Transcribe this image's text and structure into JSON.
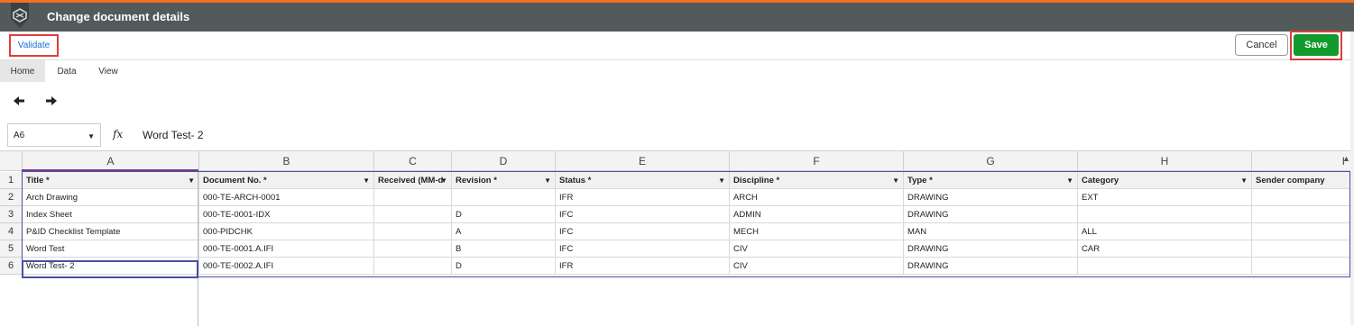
{
  "window": {
    "title": "Change document details"
  },
  "actions": {
    "validate": "Validate",
    "cancel": "Cancel",
    "save": "Save"
  },
  "tabs": [
    "Home",
    "Data",
    "View"
  ],
  "toolbar": {
    "undo_icon": "undo-arrow-icon",
    "redo_icon": "redo-arrow-icon"
  },
  "formula_bar": {
    "cell_ref": "A6",
    "fx_label": "fx",
    "value": "Word Test- 2"
  },
  "grid": {
    "column_letters": [
      "A",
      "B",
      "C",
      "D",
      "E",
      "F",
      "G",
      "H",
      "I"
    ],
    "row_numbers": [
      "1",
      "2",
      "3",
      "4",
      "5",
      "6"
    ],
    "headers": [
      "Title *",
      "Document No. *",
      "Received (MM-d",
      "Revision *",
      "Status *",
      "Discipline *",
      "Type *",
      "Category",
      "Sender company"
    ],
    "rows": [
      [
        "Arch Drawing",
        "000-TE-ARCH-0001",
        "",
        "",
        "IFR",
        "ARCH",
        "DRAWING",
        "EXT",
        ""
      ],
      [
        "Index Sheet",
        "000-TE-0001-IDX",
        "",
        "D",
        "IFC",
        "ADMIN",
        "DRAWING",
        "",
        ""
      ],
      [
        "P&ID Checklist Template",
        "000-PIDCHK",
        "",
        "A",
        "IFC",
        "MECH",
        "MAN",
        "ALL",
        ""
      ],
      [
        "Word Test",
        "000-TE-0001.A.IFI",
        "",
        "B",
        "IFC",
        "CIV",
        "DRAWING",
        "CAR",
        ""
      ],
      [
        "Word Test- 2",
        "000-TE-0002.A.IFI",
        "",
        "D",
        "IFR",
        "CIV",
        "DRAWING",
        "",
        ""
      ]
    ],
    "active_cell": "A6"
  },
  "colors": {
    "titlebar": "#525a5a",
    "accent_strip": "#f36f21",
    "save": "#119a2d",
    "highlight": "#e03c3c",
    "selection": "#4b4f9c"
  }
}
